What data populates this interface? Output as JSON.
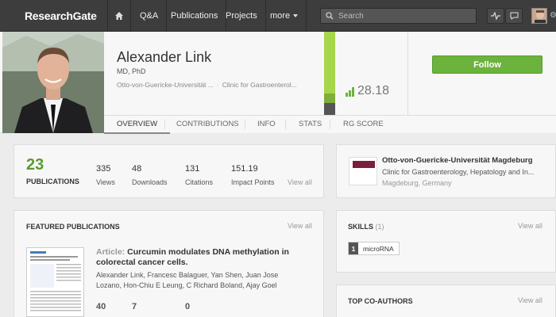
{
  "brand": "ResearchGate",
  "nav": {
    "items": [
      "Q&A",
      "Publications",
      "Projects",
      "more"
    ]
  },
  "search": {
    "placeholder": "Search"
  },
  "profile": {
    "name": "Alexander Link",
    "degree": "MD, PhD",
    "institution_short": "Otto-von-Guericke-Universität ...",
    "department_short": "Clinic for Gastroenterol...",
    "rg_score": "28.18",
    "follow_label": "Follow"
  },
  "tabs": [
    "OVERVIEW",
    "CONTRIBUTIONS",
    "INFO",
    "STATS",
    "RG SCORE"
  ],
  "stats": {
    "publications_count": "23",
    "publications_label": "PUBLICATIONS",
    "items": [
      {
        "value": "335",
        "label": "Views"
      },
      {
        "value": "48",
        "label": "Downloads"
      },
      {
        "value": "131",
        "label": "Citations"
      },
      {
        "value": "151.19",
        "label": "Impact Points"
      }
    ],
    "view_all": "View all"
  },
  "institution": {
    "name": "Otto-von-Guericke-Universität Magdeburg",
    "department": "Clinic for Gastroenterology, Hepatology and In...",
    "location": "Magdeburg, Germany"
  },
  "featured": {
    "title": "FEATURED PUBLICATIONS",
    "view_all": "View all",
    "article_kind": "Article:",
    "article_title": "Curcumin modulates DNA methylation in colorectal cancer cells.",
    "authors": "Alexander Link, Francesc Balaguer, Yan Shen, Juan Jose Lozano, Hon-Chiu E Leung, C Richard Boland, Ajay Goel",
    "stats": [
      "40",
      "7",
      "0"
    ]
  },
  "skills": {
    "title": "SKILLS",
    "count": "(1)",
    "view_all": "View all",
    "items": [
      {
        "num": "1",
        "name": "microRNA"
      }
    ]
  },
  "coauthors": {
    "title": "TOP CO-AUTHORS",
    "view_all": "View all"
  },
  "colors": {
    "accent_green": "#6cb33e",
    "topbar": "#3d3d3d"
  }
}
